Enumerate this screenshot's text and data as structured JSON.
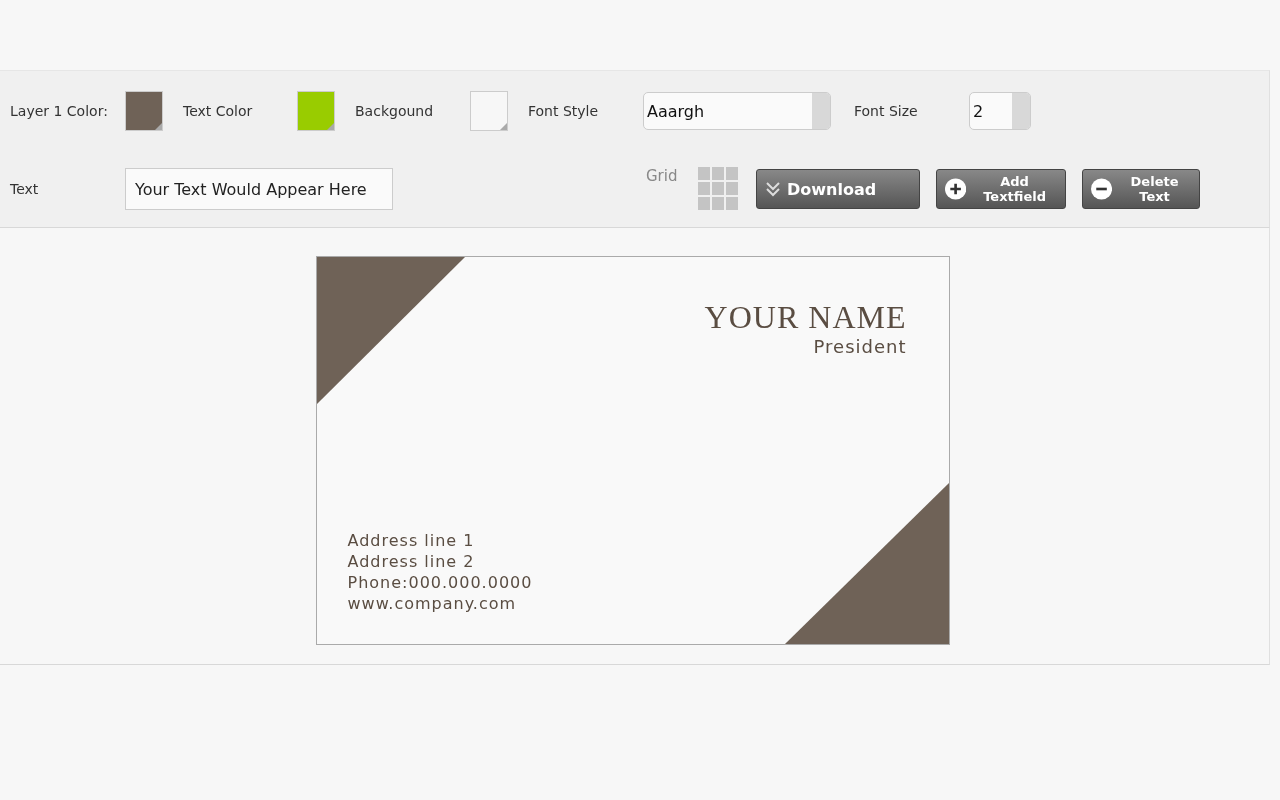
{
  "toolbar": {
    "colors": [
      {
        "label": "Layer 1 Color:",
        "color": "#6f6257"
      },
      {
        "label": "Text Color",
        "color": "#99cc00"
      },
      {
        "label": "Backgound",
        "color": "#f7f7f7"
      }
    ],
    "font_style": {
      "label": "Font Style",
      "value": "Aaargh"
    },
    "font_size": {
      "label": "Font Size",
      "value": "2"
    },
    "text": {
      "label": "Text",
      "value": "Your Text Would Appear Here"
    },
    "grid": {
      "label": "Grid"
    },
    "buttons": [
      {
        "kind": "download",
        "label": "Download"
      },
      {
        "kind": "add",
        "label": "Add Textfield"
      },
      {
        "kind": "delete",
        "label": "Delete Text"
      }
    ]
  },
  "card": {
    "name": "YOUR NAME",
    "title": "President",
    "lines": [
      "Address line 1",
      "Address line 2",
      "Phone:000.000.0000",
      "www.company.com"
    ]
  }
}
